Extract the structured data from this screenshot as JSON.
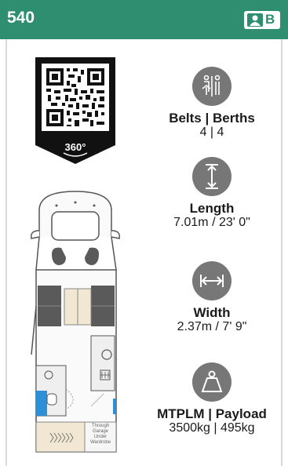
{
  "header": {
    "model": "540",
    "licence_letter": "B",
    "licence_icon": "person-icon"
  },
  "qr": {
    "badge": "360°"
  },
  "plan": {
    "wardrobe_label": "Through Garage Under Wardrobe"
  },
  "specs": [
    {
      "icon": "seat-berth-icon",
      "title": "Belts | Berths",
      "value": "4 | 4"
    },
    {
      "icon": "length-icon",
      "title": "Length",
      "value": "7.01m / 23' 0\""
    },
    {
      "icon": "width-icon",
      "title": "Width",
      "value": "2.37m / 7' 9\""
    },
    {
      "icon": "weight-icon",
      "title": "MTPLM | Payload",
      "value": "3500kg | 495kg"
    }
  ],
  "colors": {
    "header": "#2f8e6f",
    "icon_bg": "#777777",
    "plan_fill": "#5a5a5a",
    "bed": "#f1e7d2",
    "shower": "#2d8fd6"
  }
}
